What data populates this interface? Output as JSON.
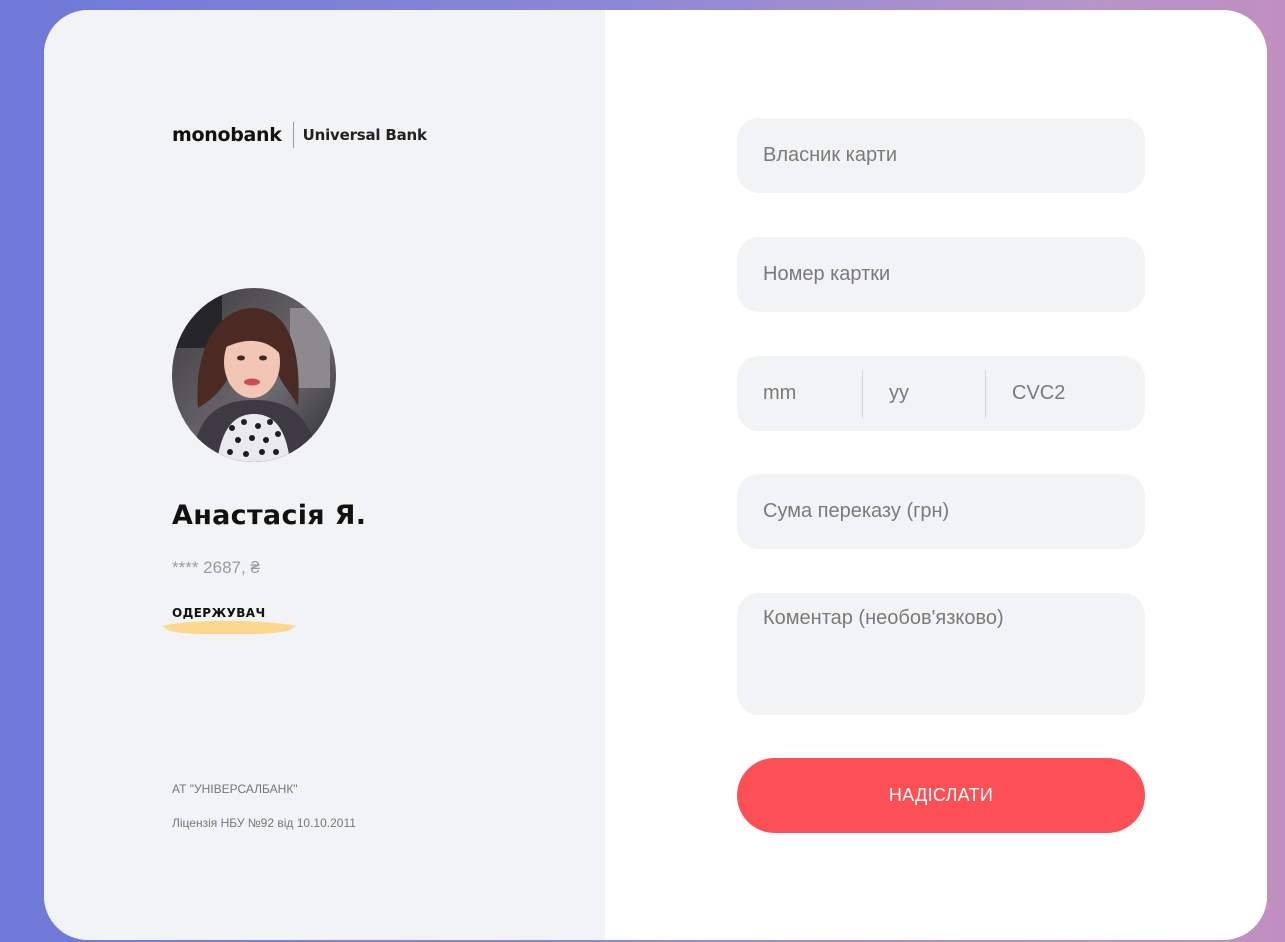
{
  "brand": {
    "logo_primary": "monobank",
    "logo_secondary": "Universal Bank"
  },
  "recipient": {
    "name": "Анастасія Я.",
    "card_mask": "**** 2687, ₴",
    "role_label": "ОДЕРЖУВАЧ",
    "badge_color": "#fcd88f"
  },
  "footer": {
    "company": "АТ \"УНІВЕРСАЛБАНК\"",
    "license": "Ліцензія НБУ №92 від 10.10.2011"
  },
  "form": {
    "card_holder_placeholder": "Власник карти",
    "card_number_placeholder": "Номер картки",
    "month_placeholder": "mm",
    "year_placeholder": "yy",
    "cvc_placeholder": "CVC2",
    "amount_placeholder": "Сума переказу (грн)",
    "comment_placeholder": "Коментар (необов'язково)",
    "submit_label": "НАДІСЛАТИ"
  },
  "colors": {
    "accent": "#fd5056",
    "field_bg": "#f2f3f5",
    "panel_bg": "#f2f3f5"
  }
}
